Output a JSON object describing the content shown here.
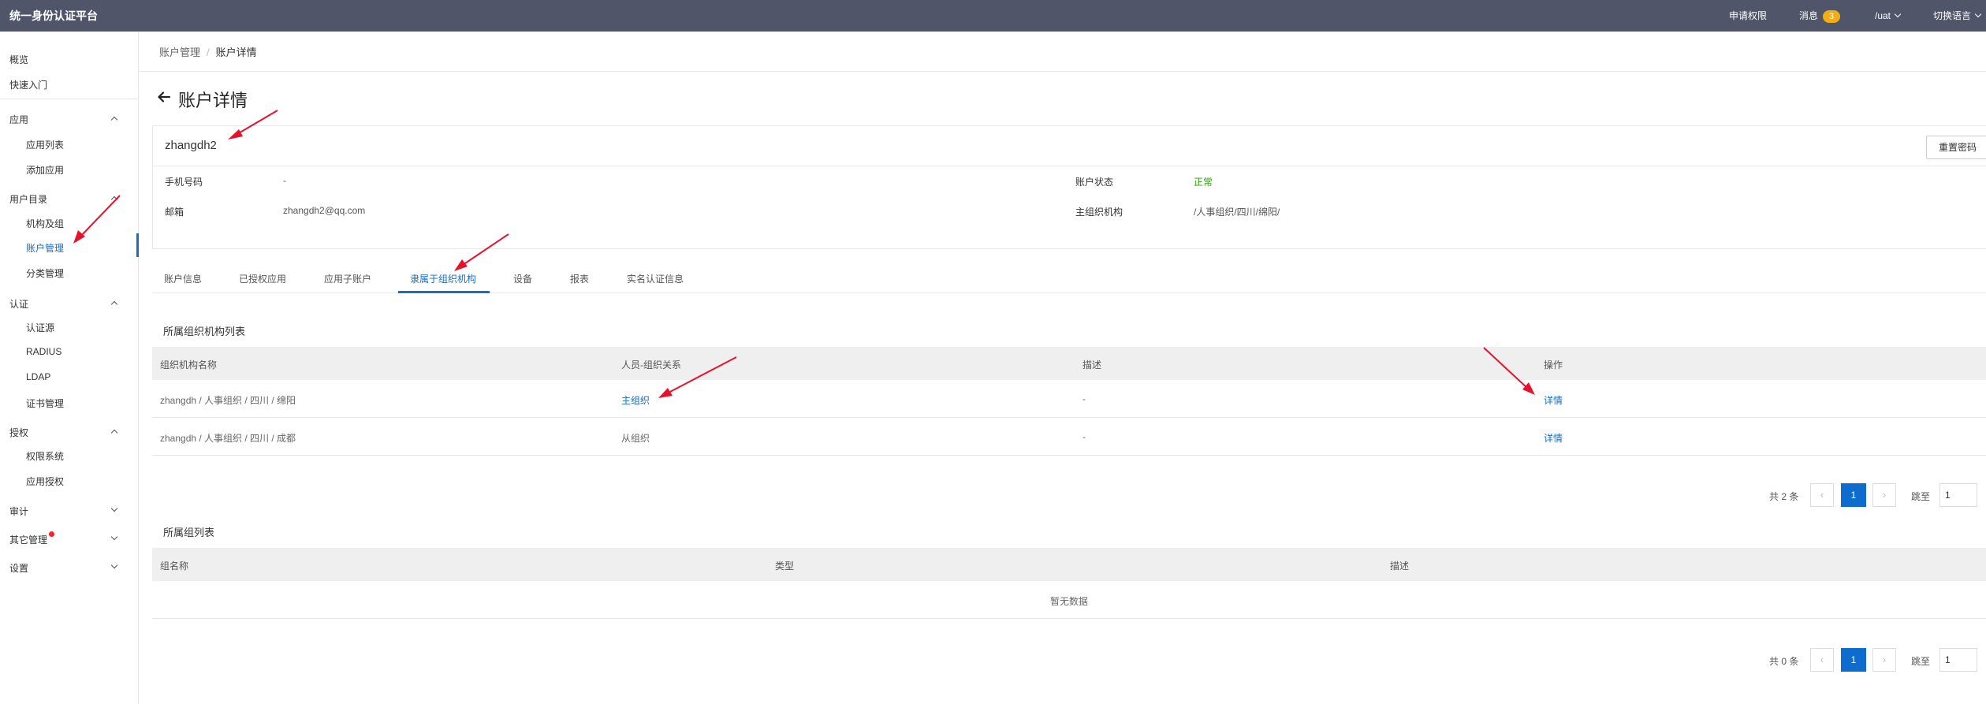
{
  "topbar": {
    "brand": "统一身份认证平台",
    "apply_permission": "申请权限",
    "messages": "消息",
    "message_count": "3",
    "tenant": "/uat",
    "switch_language": "切换语言"
  },
  "sidebar": {
    "overview": "概览",
    "quick_start": "快速入门",
    "apps": {
      "label": "应用",
      "items": [
        "应用列表",
        "添加应用"
      ]
    },
    "user_directory": {
      "label": "用户目录",
      "items": [
        "机构及组",
        "账户管理",
        "分类管理"
      ]
    },
    "auth": {
      "label": "认证",
      "items": [
        "认证源",
        "RADIUS",
        "LDAP",
        "证书管理"
      ]
    },
    "authorization": {
      "label": "授权",
      "items": [
        "权限系统",
        "应用授权"
      ]
    },
    "audit": "审计",
    "other": "其它管理",
    "settings": "设置"
  },
  "breadcrumb": {
    "parent": "账户管理",
    "current": "账户详情"
  },
  "page_title": "账户详情",
  "account": {
    "username": "zhangdh2",
    "reset_password": "重置密码",
    "phone_label": "手机号码",
    "phone": "-",
    "email_label": "邮箱",
    "email": "zhangdh2@qq.com",
    "status_label": "账户状态",
    "status": "正常",
    "primary_org_label": "主组织机构",
    "primary_org": "/人事组织/四川/绵阳/"
  },
  "tabs": [
    "账户信息",
    "已授权应用",
    "应用子账户",
    "隶属于组织机构",
    "设备",
    "报表",
    "实名认证信息"
  ],
  "org_section": {
    "title": "所属组织机构列表",
    "columns": [
      "组织机构名称",
      "人员-组织关系",
      "描述",
      "操作"
    ],
    "rows": [
      {
        "name": "zhangdh / 人事组织 / 四川 / 绵阳",
        "relation": "主组织",
        "desc": "-",
        "action": "详情"
      },
      {
        "name": "zhangdh / 人事组织 / 四川 / 成都",
        "relation": "从组织",
        "desc": "-",
        "action": "详情"
      }
    ],
    "pager": {
      "total": "共 2 条",
      "page": "1",
      "jump": "跳至",
      "jump_value": "1"
    }
  },
  "group_section": {
    "title": "所属组列表",
    "columns": [
      "组名称",
      "类型",
      "描述"
    ],
    "empty": "暂无数据",
    "pager": {
      "total": "共 0 条",
      "page": "1",
      "jump": "跳至",
      "jump_value": "1"
    }
  },
  "colors": {
    "topbar": "#505569",
    "accent": "#1b6dc1",
    "status_ok": "#2ea10b",
    "annotation": "#e8112d"
  }
}
